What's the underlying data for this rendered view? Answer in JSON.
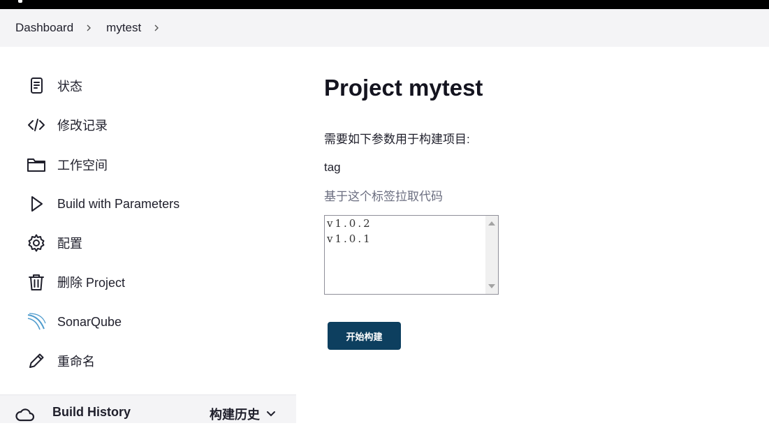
{
  "breadcrumb": {
    "items": [
      "Dashboard",
      "mytest"
    ]
  },
  "sidebar": {
    "items": [
      {
        "label": "状态",
        "icon": "status-document-icon"
      },
      {
        "label": "修改记录",
        "icon": "code-icon"
      },
      {
        "label": "工作空间",
        "icon": "folder-icon"
      },
      {
        "label": "Build with Parameters",
        "icon": "play-icon"
      },
      {
        "label": "配置",
        "icon": "gear-icon"
      },
      {
        "label": "删除 Project",
        "icon": "trash-icon"
      },
      {
        "label": "SonarQube",
        "icon": "sonarqube-icon"
      },
      {
        "label": "重命名",
        "icon": "pencil-icon"
      }
    ],
    "build_history": {
      "title": "Build History",
      "title_cn": "构建历史"
    }
  },
  "main": {
    "title": "Project mytest",
    "intro": "需要如下参数用于构建项目:",
    "parameter": {
      "name": "tag",
      "description": "基于这个标签拉取代码",
      "options": [
        "v1.0.2",
        "v1.0.1"
      ]
    },
    "build_button": "开始构建"
  },
  "colors": {
    "build_button": "#0d3f5f",
    "breadcrumb_bg": "#f4f4f6",
    "topbar": "#000000",
    "description": "#6b6e80"
  }
}
